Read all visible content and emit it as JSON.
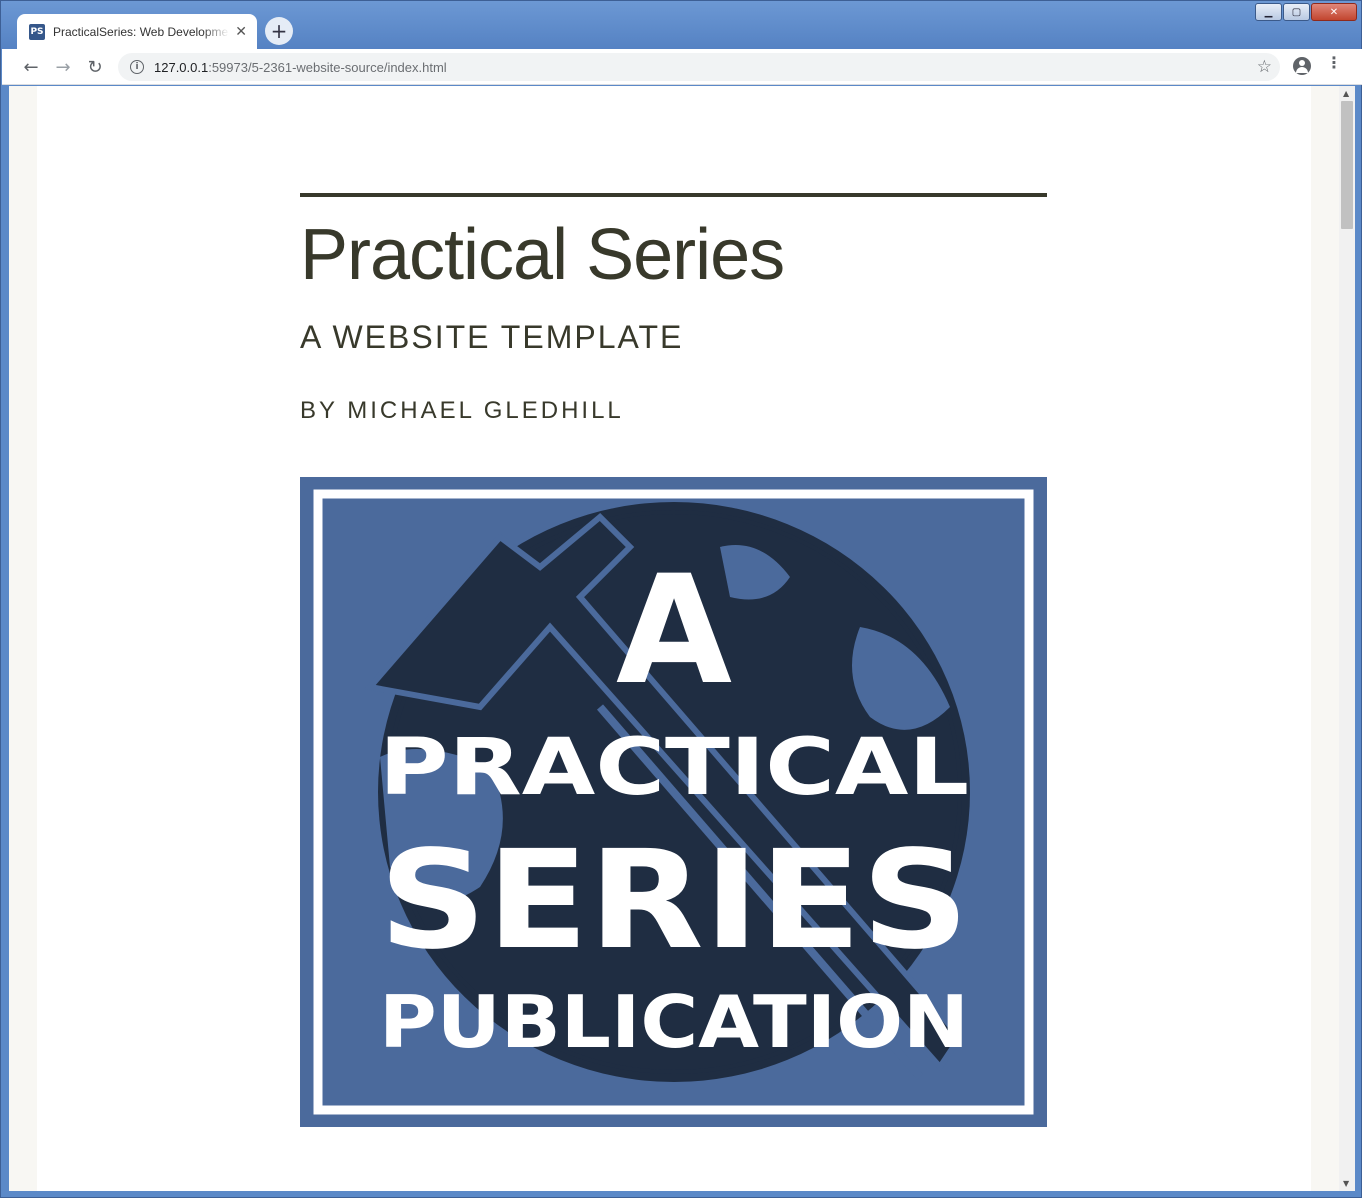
{
  "browser": {
    "tab_title": "PracticalSeries: Web Development",
    "favicon_text": "PS",
    "url_host": "127.0.0.1",
    "url_rest": ":59973/5-2361-website-source/index.html",
    "new_tab_label": "+",
    "close_tab_label": "✕"
  },
  "page": {
    "title": "Practical Series",
    "subtitle": "A WEBSITE TEMPLATE",
    "author": "BY MICHAEL GLEDHILL",
    "cover": {
      "line1": "A",
      "line2": "PRACTICAL",
      "line3": "SERIES",
      "line4": "PUBLICATION",
      "colors": {
        "background": "#4b6a9c",
        "dark": "#1f2d42",
        "frame": "#ffffff"
      }
    }
  }
}
